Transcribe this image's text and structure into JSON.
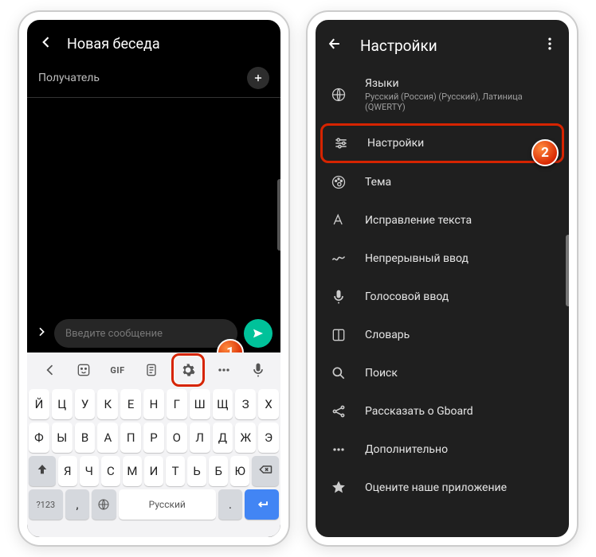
{
  "left": {
    "header": "Новая беседа",
    "recipient": "Получатель",
    "messagePlaceholder": "Введите сообщение",
    "badge": "1",
    "gif": "GIF",
    "row1": [
      "Й",
      "Ц",
      "У",
      "К",
      "Е",
      "Н",
      "Г",
      "Ш",
      "Щ",
      "З",
      "Х"
    ],
    "row2": [
      "Ф",
      "Ы",
      "В",
      "А",
      "П",
      "Р",
      "О",
      "Л",
      "Д",
      "Ж",
      "Э"
    ],
    "row3": [
      "Я",
      "Ч",
      "С",
      "М",
      "И",
      "Т",
      "Ь",
      "Б",
      "Ю"
    ],
    "numKey": "?123",
    "comma": ",",
    "space": "Русский",
    "dot": "."
  },
  "right": {
    "header": "Настройки",
    "badge": "2",
    "items": [
      {
        "label": "Языки",
        "sub": "Русский (Россия) (Русский), Латиница (QWERTY)"
      },
      {
        "label": "Настройки"
      },
      {
        "label": "Тема"
      },
      {
        "label": "Исправление текста"
      },
      {
        "label": "Непрерывный ввод"
      },
      {
        "label": "Голосовой ввод"
      },
      {
        "label": "Словарь"
      },
      {
        "label": "Поиск"
      },
      {
        "label": "Рассказать о Gboard"
      },
      {
        "label": "Дополнительно"
      },
      {
        "label": "Оцените наше приложение"
      }
    ]
  }
}
